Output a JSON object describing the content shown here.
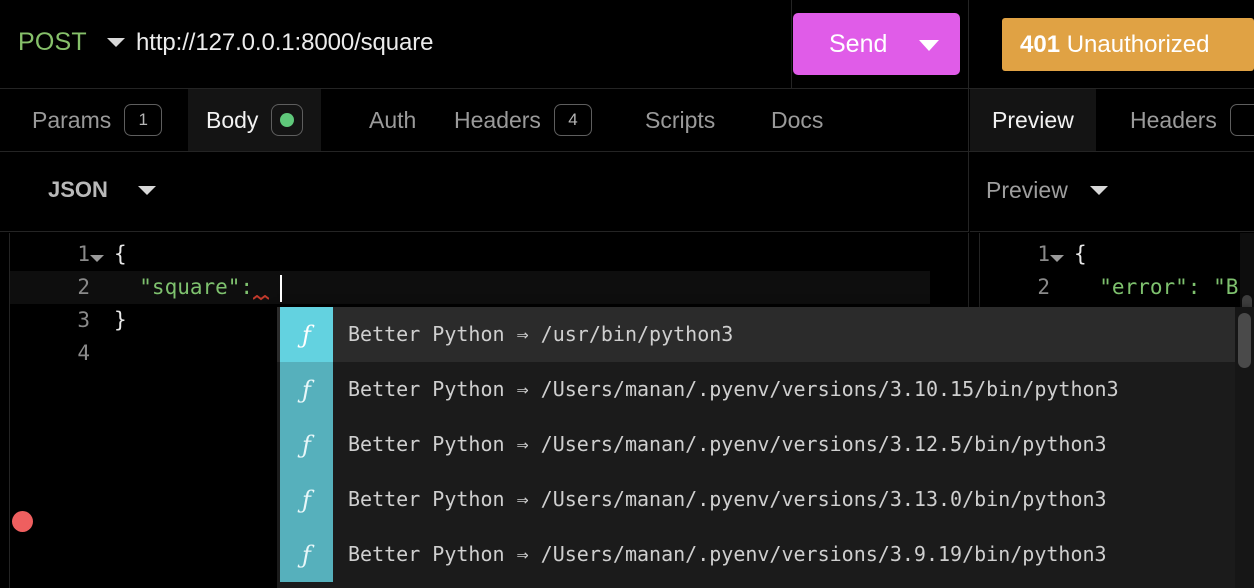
{
  "request_bar": {
    "method": "POST",
    "method_caret_icon": "chevron-down-icon",
    "url": "http://127.0.0.1:8000/square",
    "send_label": "Send",
    "send_caret_icon": "chevron-down-icon",
    "send_color": "#e05ce8"
  },
  "response_status": {
    "code": "401",
    "text": " Unauthorized",
    "color": "#e0a244"
  },
  "request_tabs": [
    {
      "label": "Params",
      "badge": "1",
      "active": false
    },
    {
      "label": "Body",
      "badge": "dot",
      "active": true
    },
    {
      "label": "Auth",
      "badge": "",
      "active": false
    },
    {
      "label": "Headers",
      "badge": "4",
      "active": false
    },
    {
      "label": "Scripts",
      "badge": "",
      "active": false
    },
    {
      "label": "Docs",
      "badge": "",
      "active": false
    }
  ],
  "response_tabs": [
    {
      "label": "Preview",
      "badge": "",
      "active": true
    },
    {
      "label": "Headers",
      "badge": "",
      "active": false
    }
  ],
  "body_format_select": {
    "label": "JSON",
    "caret_icon": "chevron-down-icon"
  },
  "preview_format_select": {
    "label": "Preview",
    "caret_icon": "chevron-down-icon"
  },
  "request_editor": {
    "breakpoint_icon": "breakpoint-dot-icon",
    "fold_icon": "fold-arrow-icon",
    "lines": [
      {
        "number": "1",
        "text": "{",
        "foldable": true
      },
      {
        "number": "2",
        "text": "  \"square\":",
        "foldable": false
      },
      {
        "number": "3",
        "text": "}",
        "foldable": false
      },
      {
        "number": "4",
        "text": "",
        "foldable": false
      }
    ],
    "error_squiggle_icon": "error-squiggle-icon"
  },
  "response_editor": {
    "lines": [
      {
        "number": "1",
        "text": "{",
        "foldable": true
      },
      {
        "number": "2",
        "text": "  \"error\": \"B",
        "foldable": false
      }
    ]
  },
  "autocomplete": {
    "scroll_icon": "scrollbar-thumb",
    "items": [
      {
        "icon": "function-icon",
        "label": "Better Python ⇒ /usr/bin/python3",
        "selected": true
      },
      {
        "icon": "function-icon",
        "label": "Better Python ⇒ /Users/manan/.pyenv/versions/3.10.15/bin/python3",
        "selected": false
      },
      {
        "icon": "function-icon",
        "label": "Better Python ⇒ /Users/manan/.pyenv/versions/3.12.5/bin/python3",
        "selected": false
      },
      {
        "icon": "function-icon",
        "label": "Better Python ⇒ /Users/manan/.pyenv/versions/3.13.0/bin/python3",
        "selected": false
      },
      {
        "icon": "function-icon",
        "label": "Better Python ⇒ /Users/manan/.pyenv/versions/3.9.19/bin/python3",
        "selected": false
      }
    ]
  }
}
